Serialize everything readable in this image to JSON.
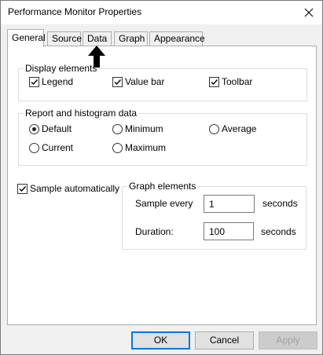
{
  "window": {
    "title": "Performance Monitor Properties"
  },
  "tabs": [
    {
      "label": "General",
      "active": true
    },
    {
      "label": "Source",
      "active": false
    },
    {
      "label": "Data",
      "active": false
    },
    {
      "label": "Graph",
      "active": false
    },
    {
      "label": "Appearance",
      "active": false
    }
  ],
  "display_elements": {
    "title": "Display elements",
    "legend": {
      "label": "Legend",
      "checked": true
    },
    "value_bar": {
      "label": "Value bar",
      "checked": true
    },
    "toolbar": {
      "label": "Toolbar",
      "checked": true
    }
  },
  "report_data": {
    "title": "Report and histogram data",
    "default": {
      "label": "Default",
      "selected": true
    },
    "minimum": {
      "label": "Minimum",
      "selected": false
    },
    "average": {
      "label": "Average",
      "selected": false
    },
    "current": {
      "label": "Current",
      "selected": false
    },
    "maximum": {
      "label": "Maximum",
      "selected": false
    }
  },
  "sample_automatically": {
    "label": "Sample automatically",
    "checked": true
  },
  "graph_elements": {
    "title": "Graph elements",
    "sample_every_label": "Sample every",
    "sample_every_value": "1",
    "sample_every_unit": "seconds",
    "duration_label": "Duration:",
    "duration_value": "100",
    "duration_unit": "seconds"
  },
  "buttons": {
    "ok": "OK",
    "cancel": "Cancel",
    "apply": "Apply"
  }
}
